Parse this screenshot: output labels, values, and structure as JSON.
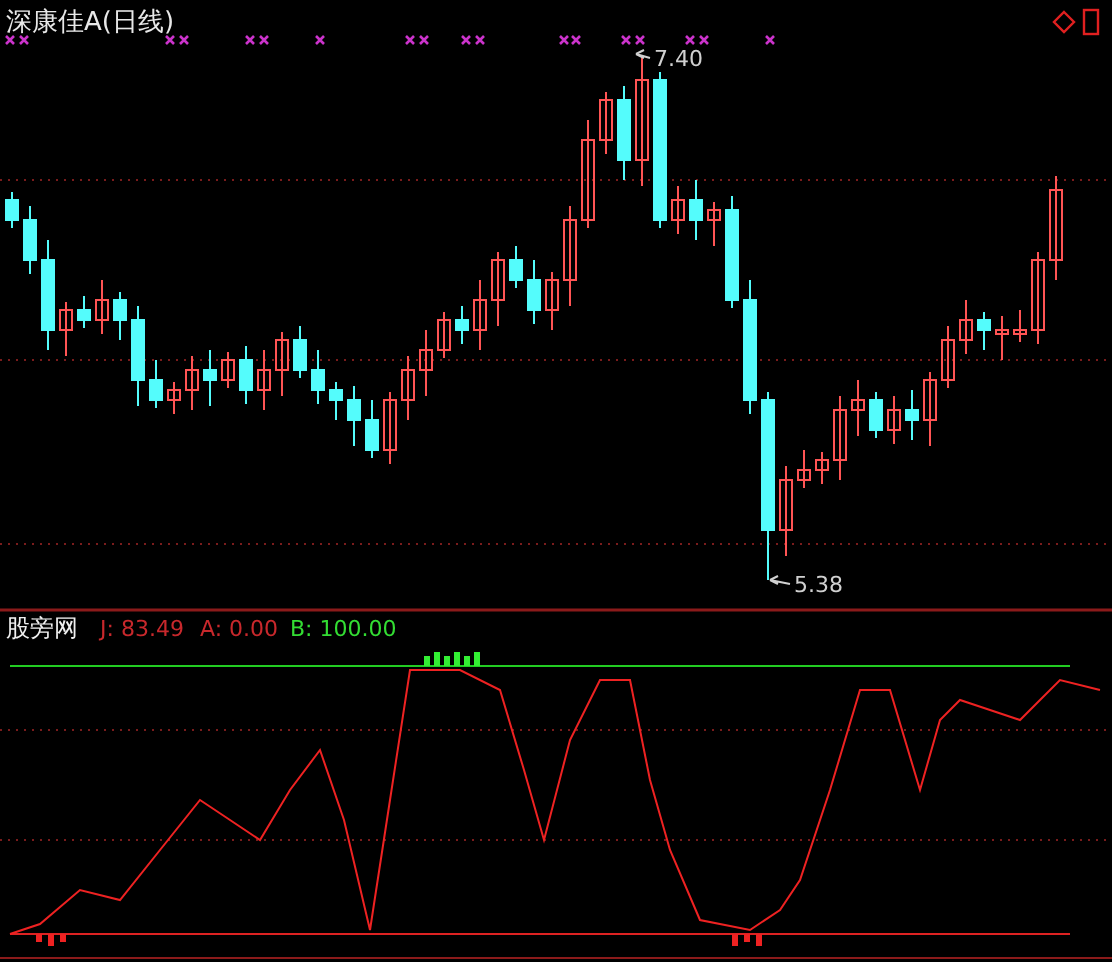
{
  "title": "深康佳A(日线)",
  "price_annotations": [
    {
      "kind": "high",
      "text": "7.40"
    },
    {
      "kind": "low",
      "text": "5.38"
    }
  ],
  "indicator": {
    "name": "股旁网",
    "readouts": [
      {
        "text": "J: 83.49",
        "color": "#c8282c"
      },
      {
        "text": "A: 0.00",
        "color": "#c8282c"
      },
      {
        "text": "B: 100.00",
        "color": "#33dd33"
      }
    ]
  }
}
